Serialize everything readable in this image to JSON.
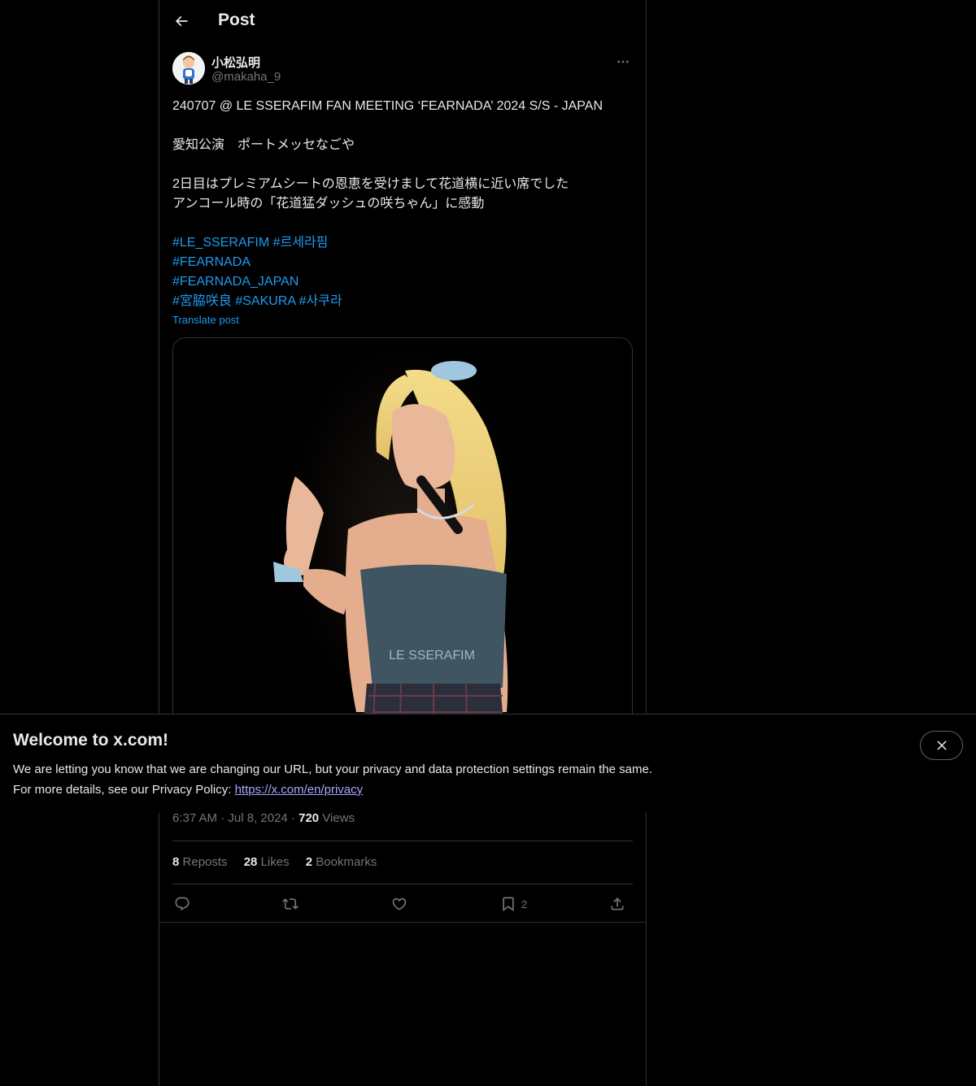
{
  "header": {
    "title": "Post"
  },
  "author": {
    "display_name": "小松弘明",
    "handle": "@makaha_9"
  },
  "post": {
    "lines": [
      "240707 @ LE SSERAFIM FAN MEETING ‘FEARNADA’ 2024 S/S - JAPAN",
      "",
      "愛知公演　ポートメッセなごや",
      "",
      "2日目はプレミアムシートの恩恵を受けまして花道横に近い席でした",
      "アンコール時の「花道猛ダッシュの咲ちゃん」に感動",
      ""
    ],
    "hashtag_lines": [
      [
        "#LE_SSERAFIM",
        "#르세라핌"
      ],
      [
        "#FEARNADA"
      ],
      [
        "#FEARNADA_JAPAN"
      ],
      [
        "#宮脇咲良",
        "#SAKURA",
        "#사쿠라"
      ]
    ],
    "translate_label": "Translate post",
    "image_text": "LE SSERAFIM"
  },
  "meta": {
    "time": "6:37 AM",
    "date": "Jul 8, 2024",
    "views_count": "720",
    "views_label": "Views",
    "separator": "·"
  },
  "stats": [
    {
      "count": "8",
      "label": "Reposts"
    },
    {
      "count": "28",
      "label": "Likes"
    },
    {
      "count": "2",
      "label": "Bookmarks"
    }
  ],
  "actions": {
    "reply_icon": "reply-icon",
    "repost_icon": "repost-icon",
    "like_icon": "heart-icon",
    "bookmark_icon": "bookmark-icon",
    "bookmark_count": "2",
    "share_icon": "share-icon"
  },
  "banner": {
    "title": "Welcome to x.com!",
    "line1": "We are letting you know that we are changing our URL, but your privacy and data protection settings remain the same.",
    "line2_prefix": "For more details, see our Privacy Policy: ",
    "link": "https://x.com/en/privacy"
  },
  "colors": {
    "accent": "#1d9bf0",
    "background": "#000000",
    "muted": "#71767b",
    "border": "#2f3336",
    "link_visited": "#a7a8ff"
  }
}
